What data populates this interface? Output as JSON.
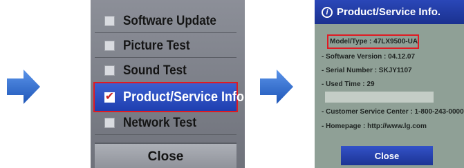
{
  "colors": {
    "arrow": "#2f6fd0",
    "highlight_border": "#e01a22",
    "selected_bg": "#2a4ec0",
    "check": "#c8201e"
  },
  "menu": {
    "items": [
      {
        "label": "Software Update",
        "checked": false,
        "selected": false
      },
      {
        "label": "Picture Test",
        "checked": false,
        "selected": false
      },
      {
        "label": "Sound Test",
        "checked": false,
        "selected": false
      },
      {
        "label": "Product/Service Info.",
        "checked": true,
        "selected": true
      },
      {
        "label": "Network Test",
        "checked": false,
        "selected": false
      }
    ],
    "close_label": "Close"
  },
  "info": {
    "icon": "info-icon",
    "title": "Product/Service Info.",
    "model": "Model/Type : 47LX9500-UA",
    "software_version": "- Software Version : 04.12.07",
    "serial_number": "- Serial Number : SKJY1107",
    "used_time": "- Used Time : 29",
    "customer_service": "- Customer Service Center : 1-800-243-0000",
    "homepage": "- Homepage : http://www.lg.com",
    "close_label": "Close"
  }
}
